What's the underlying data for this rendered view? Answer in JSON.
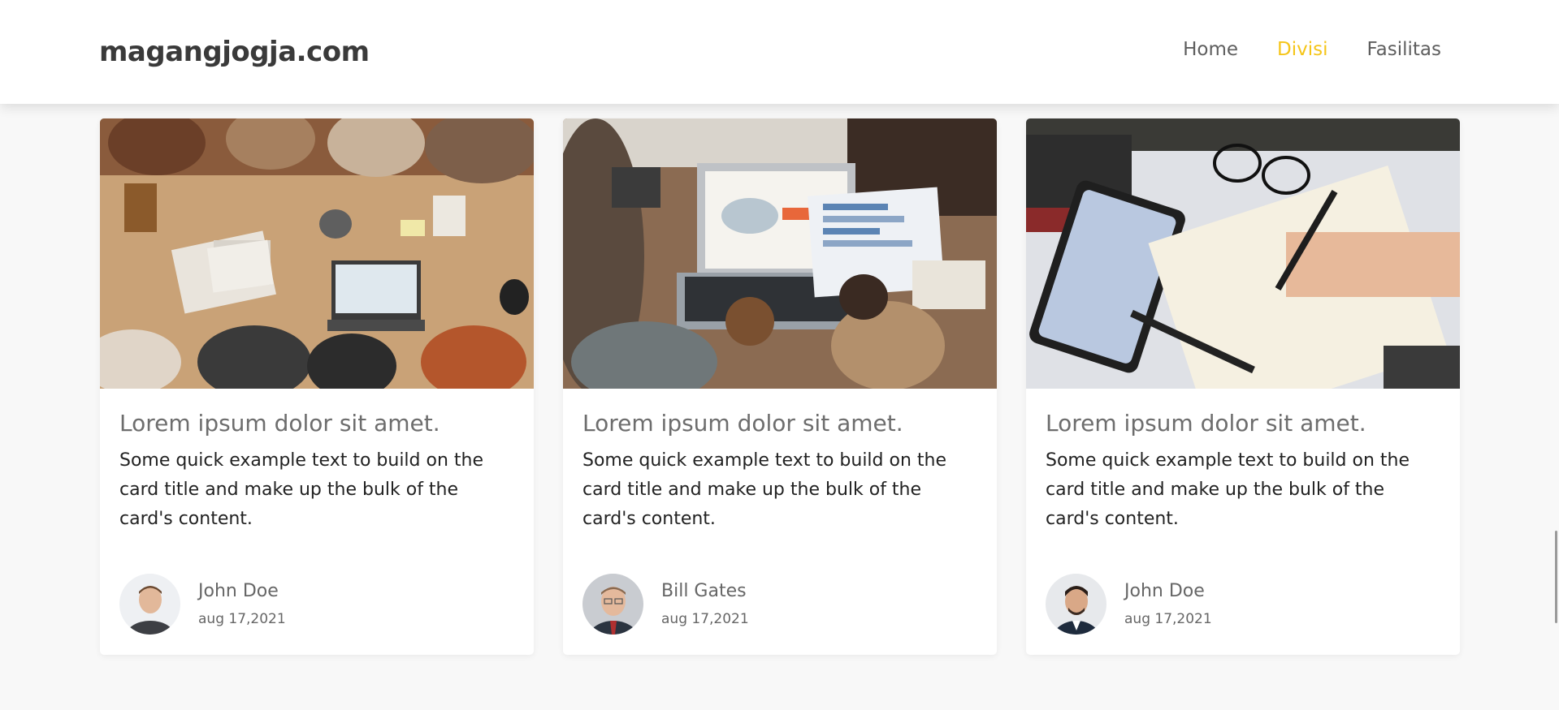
{
  "navbar": {
    "brand": "magangjogja.com",
    "links": [
      "Home",
      "Divisi",
      "Fasilitas"
    ],
    "active_link": "Divisi",
    "accent_color": "#f5c518"
  },
  "cards": [
    {
      "image": "team-meeting-table-photo",
      "title": "Lorem ipsum dolor sit amet.",
      "text": "Some quick example text to build on the card title and make up the bulk of the card's content.",
      "author": "John Doe",
      "date": "aug 17,2021"
    },
    {
      "image": "laptop-charts-photo",
      "title": "Lorem ipsum dolor sit amet.",
      "text": "Some quick example text to build on the card title and make up the bulk of the card's content.",
      "author": "Bill Gates",
      "date": "aug 17,2021"
    },
    {
      "image": "phone-notebook-writing-photo",
      "title": "Lorem ipsum dolor sit amet.",
      "text": "Some quick example text to build on the card title and make up the bulk of the card's content.",
      "author": "John Doe",
      "date": "aug 17,2021"
    }
  ]
}
